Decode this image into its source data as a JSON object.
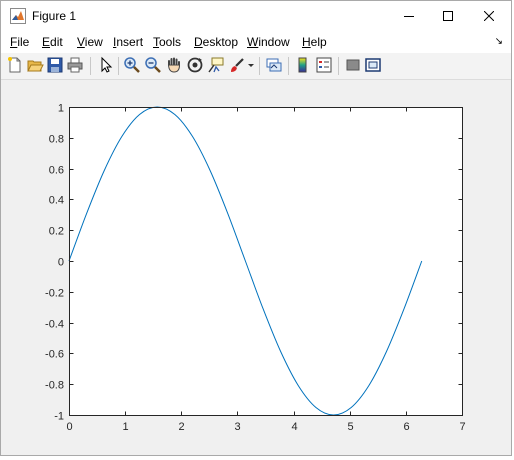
{
  "window": {
    "title": "Figure 1"
  },
  "menu": [
    {
      "id": "file",
      "first": "F",
      "rest": "ile"
    },
    {
      "id": "edit",
      "first": "E",
      "rest": "dit"
    },
    {
      "id": "view",
      "first": "V",
      "rest": "iew"
    },
    {
      "id": "insert",
      "first": "I",
      "rest": "nsert"
    },
    {
      "id": "tools",
      "first": "T",
      "rest": "ools"
    },
    {
      "id": "desktop",
      "first": "D",
      "rest": "esktop"
    },
    {
      "id": "window",
      "first": "W",
      "rest": "indow"
    },
    {
      "id": "help",
      "first": "H",
      "rest": "elp"
    }
  ],
  "toolbar": [
    "new-figure-icon",
    "open-file-icon",
    "save-icon",
    "print-icon",
    "edit-plot-arrow-icon",
    "zoom-in-icon",
    "zoom-out-icon",
    "pan-hand-icon",
    "rotate-3d-icon",
    "data-cursor-icon",
    "brush-icon",
    "brush-dropdown-icon",
    "link-plot-icon",
    "insert-colorbar-icon",
    "insert-legend-icon",
    "hide-plot-tools-icon",
    "show-plot-tools-icon"
  ],
  "colors": {
    "line": "#0072bd",
    "axes_bg": "#ffffff",
    "figure_bg": "#f0f0f0"
  },
  "chart_data": {
    "type": "line",
    "title": "",
    "xlabel": "",
    "ylabel": "",
    "xlim": [
      0,
      7
    ],
    "ylim": [
      -1,
      1
    ],
    "xticks": [
      "0",
      "1",
      "2",
      "3",
      "4",
      "5",
      "6",
      "7"
    ],
    "yticks": [
      "-1",
      "-0.8",
      "-0.6",
      "-0.4",
      "-0.2",
      "0",
      "0.2",
      "0.4",
      "0.6",
      "0.8",
      "1"
    ],
    "grid": false,
    "series": [
      {
        "color": "#0072bd",
        "x": [
          0,
          0.3142,
          0.6283,
          0.9425,
          1.2566,
          1.5708,
          1.885,
          2.1991,
          2.5133,
          2.8274,
          3.1416,
          3.4558,
          3.7699,
          4.0841,
          4.3982,
          4.7124,
          5.0265,
          5.3407,
          5.6549,
          5.969,
          6.2832
        ],
        "y": [
          0,
          0.309,
          0.5878,
          0.809,
          0.9511,
          1,
          0.9511,
          0.809,
          0.5878,
          0.309,
          0,
          -0.309,
          -0.5878,
          -0.809,
          -0.9511,
          -1,
          -0.9511,
          -0.809,
          -0.5878,
          -0.309,
          0
        ]
      }
    ]
  }
}
